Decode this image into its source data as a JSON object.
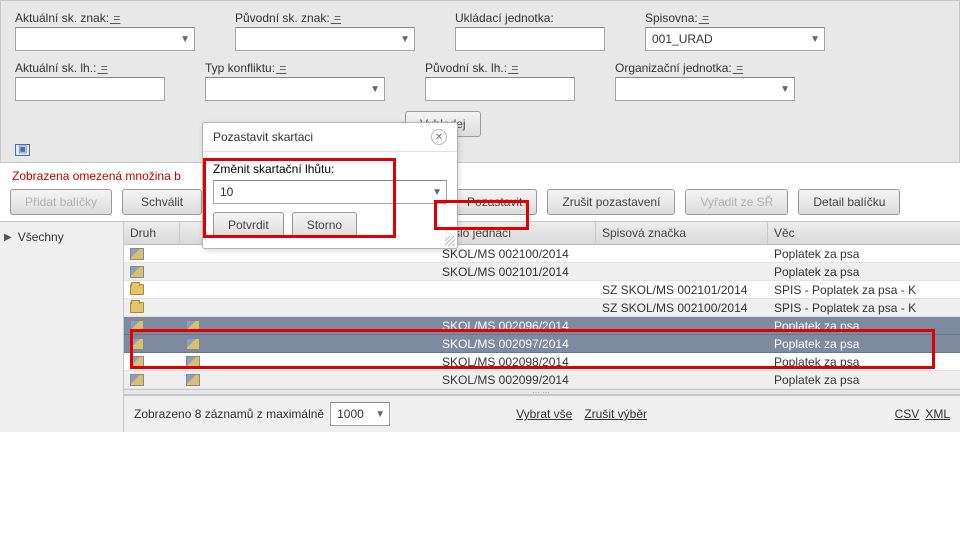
{
  "filters": {
    "row1": [
      {
        "label": "Aktuální sk. znak:",
        "eq": "=",
        "type": "select",
        "value": ""
      },
      {
        "label": "Původní sk. znak:",
        "eq": "=",
        "type": "select",
        "value": ""
      },
      {
        "label": "Ukládací jednotka:",
        "eq": "",
        "type": "text",
        "value": ""
      },
      {
        "label": "Spisovna:",
        "eq": "=",
        "type": "select",
        "value": "001_URAD"
      }
    ],
    "row2": [
      {
        "label": "Aktuální sk. lh.:",
        "eq": "=",
        "type": "text",
        "value": ""
      },
      {
        "label": "Typ konfliktu:",
        "eq": "=",
        "type": "select",
        "value": ""
      },
      {
        "label": "Původní sk. lh.:",
        "eq": "=",
        "type": "text",
        "value": ""
      },
      {
        "label": "Organizační jednotka:",
        "eq": "=",
        "type": "select",
        "value": ""
      }
    ],
    "search_btn": "Vyhledej"
  },
  "collapse_glyph": "▣",
  "limited_msg": "Zobrazena omezená množina b",
  "toolbar": {
    "pridat": "Přidat balíčky",
    "schvalit": "Schválit",
    "pozastavit": "Pozastavit",
    "zrusit": "Zrušit pozastavení",
    "vyradit": "Vyřadit ze SŘ",
    "detail": "Detail balíčku"
  },
  "sidebar": {
    "vsechny": "Všechny"
  },
  "grid": {
    "head": {
      "druh": "Druh",
      "cj": "Číslo jednací",
      "sz": "Spisová značka",
      "vec": "Věc"
    },
    "rows": [
      {
        "t": "doc",
        "cj": "SKOL/MS 002100/2014",
        "sz": "",
        "vec": "Poplatek za psa",
        "alt": false,
        "sel": false
      },
      {
        "t": "doc",
        "cj": "SKOL/MS 002101/2014",
        "sz": "",
        "vec": "Poplatek za psa",
        "alt": true,
        "sel": false
      },
      {
        "t": "fld",
        "cj": "",
        "sz": "SZ SKOL/MS 002101/2014",
        "vec": "SPIS - Poplatek za psa - K",
        "alt": false,
        "sel": false
      },
      {
        "t": "fld",
        "cj": "",
        "sz": "SZ SKOL/MS 002100/2014",
        "vec": "SPIS - Poplatek za psa - K",
        "alt": true,
        "sel": false
      },
      {
        "t": "doc2",
        "cj": "SKOL/MS 002096/2014",
        "sz": "",
        "vec": "Poplatek za psa",
        "alt": false,
        "sel": true
      },
      {
        "t": "doc2",
        "cj": "SKOL/MS 002097/2014",
        "sz": "",
        "vec": "Poplatek za psa",
        "alt": true,
        "sel": true
      },
      {
        "t": "doc2",
        "cj": "SKOL/MS 002098/2014",
        "sz": "",
        "vec": "Poplatek za psa",
        "alt": false,
        "sel": false
      },
      {
        "t": "doc2",
        "cj": "SKOL/MS 002099/2014",
        "sz": "",
        "vec": "Poplatek za psa",
        "alt": true,
        "sel": false
      }
    ]
  },
  "footer": {
    "count_prefix": "Zobrazeno 8 záznamů z maximálně",
    "max": "1000",
    "vybrat": "Vybrat vše",
    "zrusit": "Zrušit výběr",
    "csv": "CSV",
    "xml": "XML"
  },
  "modal": {
    "title": "Pozastavit skartaci",
    "label": "Změnit skartační lhůtu:",
    "value": "10",
    "confirm": "Potvrdit",
    "cancel": "Storno"
  }
}
